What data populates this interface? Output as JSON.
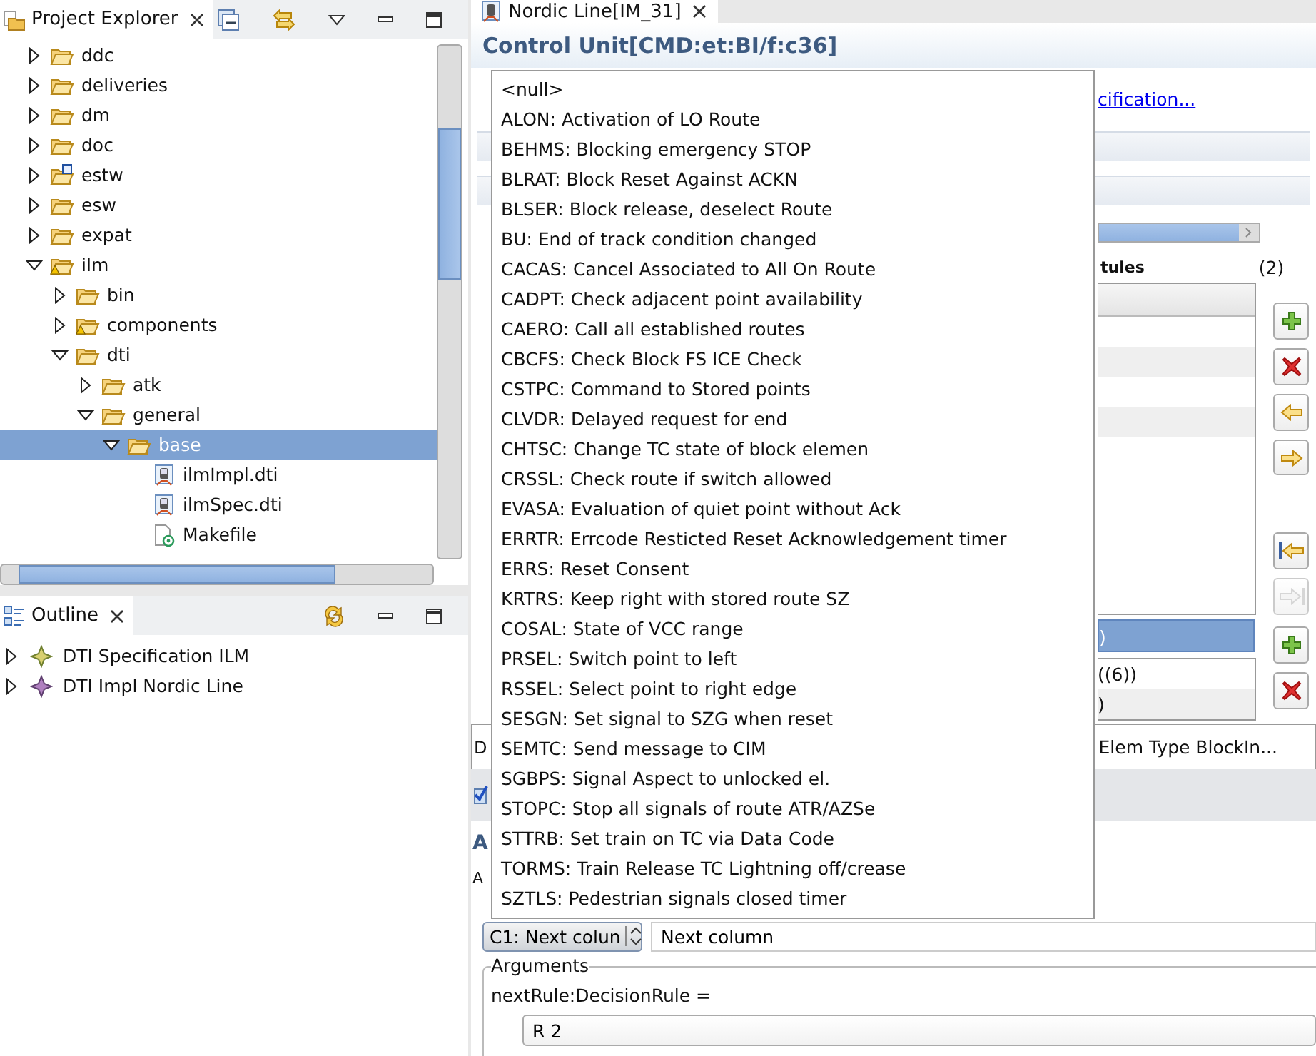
{
  "project_explorer": {
    "title": "Project Explorer",
    "tree": [
      {
        "name": "ddc",
        "kind": "folder",
        "expanded": false,
        "selected": false
      },
      {
        "name": "deliveries",
        "kind": "folder",
        "expanded": false,
        "selected": false
      },
      {
        "name": "dm",
        "kind": "folder",
        "expanded": false,
        "selected": false
      },
      {
        "name": "doc",
        "kind": "folder",
        "expanded": false,
        "selected": false
      },
      {
        "name": "estw",
        "kind": "checked-folder",
        "expanded": false,
        "selected": false
      },
      {
        "name": "esw",
        "kind": "folder",
        "expanded": false,
        "selected": false
      },
      {
        "name": "expat",
        "kind": "folder",
        "expanded": false,
        "selected": false
      },
      {
        "name": "ilm",
        "kind": "warning-folder",
        "expanded": true,
        "selected": false,
        "children": [
          {
            "name": "bin",
            "kind": "folder",
            "expanded": false,
            "selected": false
          },
          {
            "name": "components",
            "kind": "warning-folder",
            "expanded": false,
            "selected": false
          },
          {
            "name": "dti",
            "kind": "folder",
            "expanded": true,
            "selected": false,
            "children": [
              {
                "name": "atk",
                "kind": "folder",
                "expanded": false,
                "selected": false
              },
              {
                "name": "general",
                "kind": "folder",
                "expanded": true,
                "selected": false,
                "children": [
                  {
                    "name": "base",
                    "kind": "folder",
                    "expanded": true,
                    "selected": true,
                    "children": [
                      {
                        "name": "ilmImpl.dti",
                        "kind": "dti",
                        "selected": false
                      },
                      {
                        "name": "ilmSpec.dti",
                        "kind": "dti",
                        "selected": false
                      },
                      {
                        "name": "Makefile",
                        "kind": "makefile",
                        "selected": false
                      }
                    ]
                  }
                ]
              }
            ]
          }
        ]
      }
    ]
  },
  "outline": {
    "title": "Outline",
    "items": [
      {
        "name": "DTI Specification ILM",
        "kind": "spec",
        "expanded": false
      },
      {
        "name": "DTI Impl Nordic Line",
        "kind": "impl",
        "expanded": false
      }
    ]
  },
  "editor": {
    "tab": "Nordic Line[IM_31]",
    "header": "Control Unit[CMD:et:BI/f:c36]",
    "link": "cification...",
    "section_label": "tules",
    "count": "(2)",
    "selected_row": ")",
    "list_rows": [
      "((6))",
      ")"
    ],
    "tab_left": "D",
    "tab_right": "Elem Type BlockIn...",
    "heading": "A",
    "field_label": "A",
    "combo": "C1: Next colun",
    "combo_text": "Next column",
    "arguments": {
      "title": "Arguments",
      "label": "nextRule:DecisionRule =",
      "value": "R 2"
    },
    "dropdown": [
      "<null>",
      "ALON: Activation of  LO Route",
      "BEHMS: Blocking emergency STOP",
      "BLRAT: Block Reset Against ACKN",
      "BLSER: Block release, deselect Route",
      "BU: End of track condition changed",
      "CACAS: Cancel Associated to All On Route",
      "CADPT: Check adjacent point availability",
      "CAERO: Call all established routes",
      "CBCFS: Check Block FS ICE Check",
      "CSTPC: Command to Stored points",
      "CLVDR: Delayed request for end",
      "CHTSC: Change TC state of block elemen",
      "CRSSL: Check route if switch allowed",
      "EVASA: Evaluation of quiet point without Ack",
      "ERRTR: Errcode Resticted Reset Acknowledgement timer",
      "ERRS: Reset Consent",
      "KRTRS: Keep right with stored route SZ",
      "COSAL: State of VCC range",
      "PRSEL: Switch point to left",
      "RSSEL: Select point to right edge",
      "SESGN: Set signal to SZG when reset",
      "SEMTC: Send message to CIM",
      "SGBPS: Signal Aspect to unlocked el.",
      "STOPC: Stop all signals of route ATR/AZSe",
      "STTRB: Set train on TC via Data Code",
      "TORMS: Train Release TC Lightning off/crease",
      "SZTLS: Pedestrian signals closed timer"
    ]
  }
}
